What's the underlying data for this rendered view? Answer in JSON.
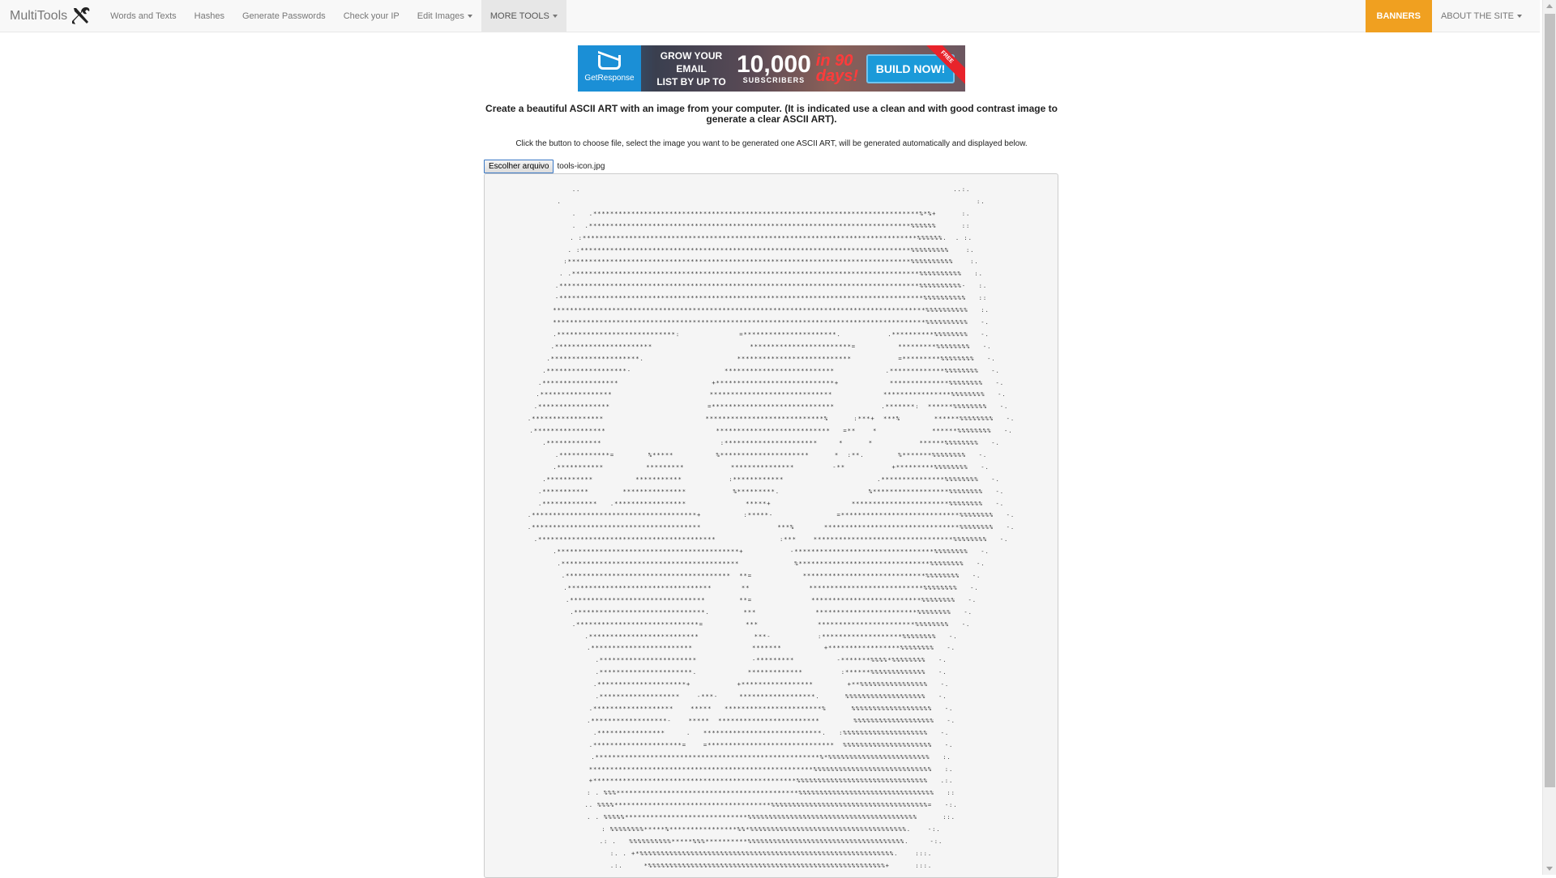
{
  "navbar": {
    "brand": "MultiTools",
    "items": [
      {
        "label": "Words and Texts"
      },
      {
        "label": "Hashes"
      },
      {
        "label": "Generate Passwords"
      },
      {
        "label": "Check your IP"
      },
      {
        "label": "Edit Images"
      },
      {
        "label": "MORE TOOLS"
      }
    ],
    "banners_label": "BANNERS",
    "about_label": "ABOUT THE SITE"
  },
  "ad_banner": {
    "logo_text": "GetResponse",
    "line1": "GROW YOUR EMAIL",
    "line2": "LIST BY UP TO",
    "number": "10,000",
    "subscribers": "SUBSCRIBERS",
    "days": "in 90 days!",
    "cta": "BUILD NOW!",
    "ribbon": "FREE"
  },
  "main": {
    "headline": "Create a beautiful ASCII ART with an image from your computer. (It is indicated use a clean and with good contrast image to generate a clear ASCII ART).",
    "instructions": "Click the button to choose file, select the image you want to be generated one ASCII ART, will be generated automatically and displayed below.",
    "file_button_label": "Escolher arquivo",
    "file_name": "tools-icon.jpg"
  },
  "ascii_art": "..                                                                                        ..:.\n.                                                                                                  :.\n.   .*****************************************************************************%*%+      :.\n.  .****************************************************************************%%%%%%      ::\n. :*******************************************************************************%%%%%%.  . :.\n. :******************************************************************************%%%%%%%%%    :.\n:*********************************************************************************%%%%%%%%%%    :.\n. .**********************************************************************************%%%%%%%%%%   :.\n.*************************************************************************************%%%%%%%%%%-   :.\n-**************************************************************************************%%%%%%%%%%   ::\n****************************************************************************************%%%%%%%%%%   :.\n****************************************************************************************%%%%%%%%%%   -.\n.****************************:              =**********************.           .**********%%%%%%%%   -.\n.***********************                       ************************=          *********%%%%%%%%   -.\n.*********************.                      ***************************           =*********%%%%%%%%   -.\n.*******************-                      **************************            .*************%%%%%%%%   -.\n.******************                      +****************************+            **************%%%%%%%%   -.\n.*****************                       *****************************            ****************%%%%%%%%   -.\n.*****************                       =*****************************           .*******:  ******%%%%%%%%   -.\n.*****************                        ****************************%      :***+  ***%        ******%%%%%%%%   -.\n.*****************                          ***************************   =**    *             ******%%%%%%%%   -.\n.*************                            :**********************     *      *           ******%%%%%%%%   -.\n.************=        %*****          %*********************      *  :**.        %*******%%%%%%%%   -.\n.***********          *********           ***************         -**           +*********%%%%%%%%   -.\n.***********          ***********           :************                      .***************%%%%%%%%   -.\n.***********        ***************           %*********.                     %******************%%%%%%%%   -.\n.*************   .*****************              *****+                   ***********************%%%%%%%%   -.\n.***************************************+          :*****-               =****************************%%%%%%%%   -.\n.****************************************                  ***%       ********************************%%%%%%%%   -.\n.******************************************               :***    *********************************%%%%%%%%   -.\n.*******************************************+           -*********************************%%%%%%%%   -.\n.******************************************             %*******************************%%%%%%%%   -.\n.***************************************  **=            *****************************%%%%%%%%   -.\n.**********************************       **              ***************************%%%%%%%%   -.\n.********************************        **=              **************************%%%%%%%%   -.\n.*******************************.        ***              ************************%%%%%%%%   -.\n.*****************************=          ***              ***********************%%%%%%%%   -.\n.**************************             ***-           :*******************%%%%%%%%   -.\n.************************              *******          +*****************%%%%%%%%   -.\n.***********************             -*********          -*******%%%%*%%%%%%%%   -.\n.**********************.            *************         :******%%%%%%%%%%%%%   -.\n.*********************+           +*****************        +**%%%%%%%%%%%%%%%%   -.\n.*******************    -***-     ******************.      %%%%%%%%%%%%%%%%%%%   -.\n.*******************    *****   ***********************%      %%%%%%%%%%%%%%%%%%%   -.\n.******************-    *****  ************************        %%%%%%%%%%%%%%%%%%%   -.\n.****************     .   ****************************.   :%%%%%%%%%%%%%%%%%%%%   -.\n.*********************=    =******************************  %%%%%%%%%%%%%%%%%%%%%   -.\n.*****************************************************%*%%%%%%%%%%%%%%%%%%%%%%%%   :.\n*****************************************************%%%%%%%%%%%%%%%%%%%%%%%%%%%%   :.\n+************************************************%%%%%%%%%%%%%%%%%%%%%%%%%%%%%%%   .:.\n: . %%%*******************************************%%%%%%%%%%%%%%%%%%%%%%%%%%%%%%%%   ::\n.. %%%%*************************************%%%%%%%%%%%%%%%%%%%%%%%%%%%%%%%%%%%%%=   -:.\n. . %%%%%*****************************%%%%%%%%%%%%%%%%%%%%%%%%%%%%%%%%%%%%%%%%      ::.\n: %%%%%%%%*****%****************%%*%%%%%%%%%%%%%%%%%%%%%%%%%%%%%%%%%%%%%.    -:.\n.: .   %%%%%%%%%%*****%%%**********%%%%%%%%%%%%%%%%%%%%%%%%%%%%%%%%%%%%%.     -:.\n:. . +*%%%%%%%%%%%%%%%%%%%%%%%%%%%%%%%%%%%%%%%%%%%%%%%%%%%%%%%%%%%%.    :::.\n.:.     *%%%%%%%%%%%%%%%%%%%%%%%%%%%%%%%%%%%%%%%%%%%%%%%%%%%%%%%%+      :::."
}
